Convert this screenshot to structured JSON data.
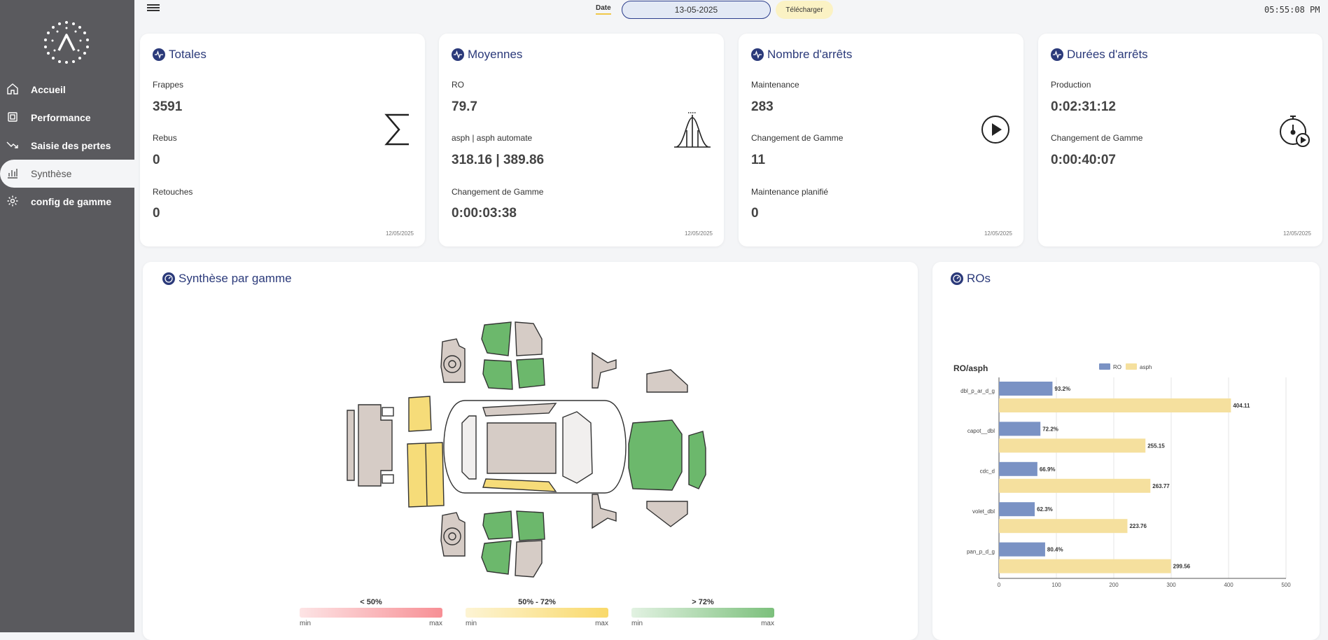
{
  "sidebar": {
    "items": [
      {
        "label": "Accueil",
        "icon": "home-icon"
      },
      {
        "label": "Performance",
        "icon": "chip-icon"
      },
      {
        "label": "Saisie des pertes",
        "icon": "trend-down-icon"
      },
      {
        "label": "Synthèse",
        "icon": "bar-chart-icon"
      },
      {
        "label": "config de gamme",
        "icon": "gear-icon"
      }
    ],
    "active_index": 3
  },
  "topbar": {
    "date_label": "Date",
    "date_value": "13-05-2025",
    "download_label": "Télécharger",
    "clock": "05:55:08 PM"
  },
  "cards": {
    "totales": {
      "title": "Totales",
      "stats": [
        {
          "label": "Frappes",
          "value": "3591"
        },
        {
          "label": "Rebus",
          "value": "0"
        },
        {
          "label": "Retouches",
          "value": "0"
        }
      ],
      "date": "12/05/2025"
    },
    "moyennes": {
      "title": "Moyennes",
      "stats": [
        {
          "label": "RO",
          "value": "79.7"
        },
        {
          "label": "asph | asph automate",
          "value": "318.16 | 389.86"
        },
        {
          "label": "Changement de Gamme",
          "value": "0:00:03:38"
        }
      ],
      "date": "12/05/2025"
    },
    "arrets": {
      "title": "Nombre d'arrêts",
      "stats": [
        {
          "label": "Maintenance",
          "value": "283"
        },
        {
          "label": "Changement de Gamme",
          "value": "11"
        },
        {
          "label": "Maintenance planifié",
          "value": "0"
        }
      ],
      "date": "12/05/2025"
    },
    "durees": {
      "title": "Durées d'arrêts",
      "stats": [
        {
          "label": "Production",
          "value": "0:02:31:12"
        },
        {
          "label": "Changement de Gamme",
          "value": "0:00:40:07"
        }
      ],
      "date": "12/05/2025"
    }
  },
  "synthese": {
    "title": "Synthèse par gamme",
    "legend": [
      {
        "label": "< 50%",
        "min": "min",
        "max": "max",
        "color": "#f78f95"
      },
      {
        "label": "50% - 72%",
        "min": "min",
        "max": "max",
        "color": "#f9d96a"
      },
      {
        "label": "> 72%",
        "min": "min",
        "max": "max",
        "color": "#7cc07c"
      }
    ]
  },
  "ros": {
    "title": "ROs",
    "chart_data": {
      "type": "bar",
      "orientation": "horizontal",
      "title": "RO/asph",
      "categories": [
        "dbl_p_ar_d_g",
        "capot__dbl",
        "cdc_d",
        "volet_dbl",
        "pan_p_d_g"
      ],
      "series": [
        {
          "name": "RO",
          "color": "#7a92c4",
          "values": [
            93.2,
            72.2,
            66.9,
            62.3,
            80.4
          ],
          "labels": [
            "93.2%",
            "72.2%",
            "66.9%",
            "62.3%",
            "80.4%"
          ]
        },
        {
          "name": "asph",
          "color": "#f5e09e",
          "values": [
            404.11,
            255.15,
            263.77,
            223.76,
            299.56
          ],
          "labels": [
            "404.11",
            "255.15",
            "263.77",
            "223.76",
            "299.56"
          ]
        }
      ],
      "xlim": [
        0,
        500
      ],
      "xticks": [
        "0",
        "100",
        "200",
        "300",
        "400",
        "500"
      ],
      "legend": "top",
      "grid": true
    }
  }
}
